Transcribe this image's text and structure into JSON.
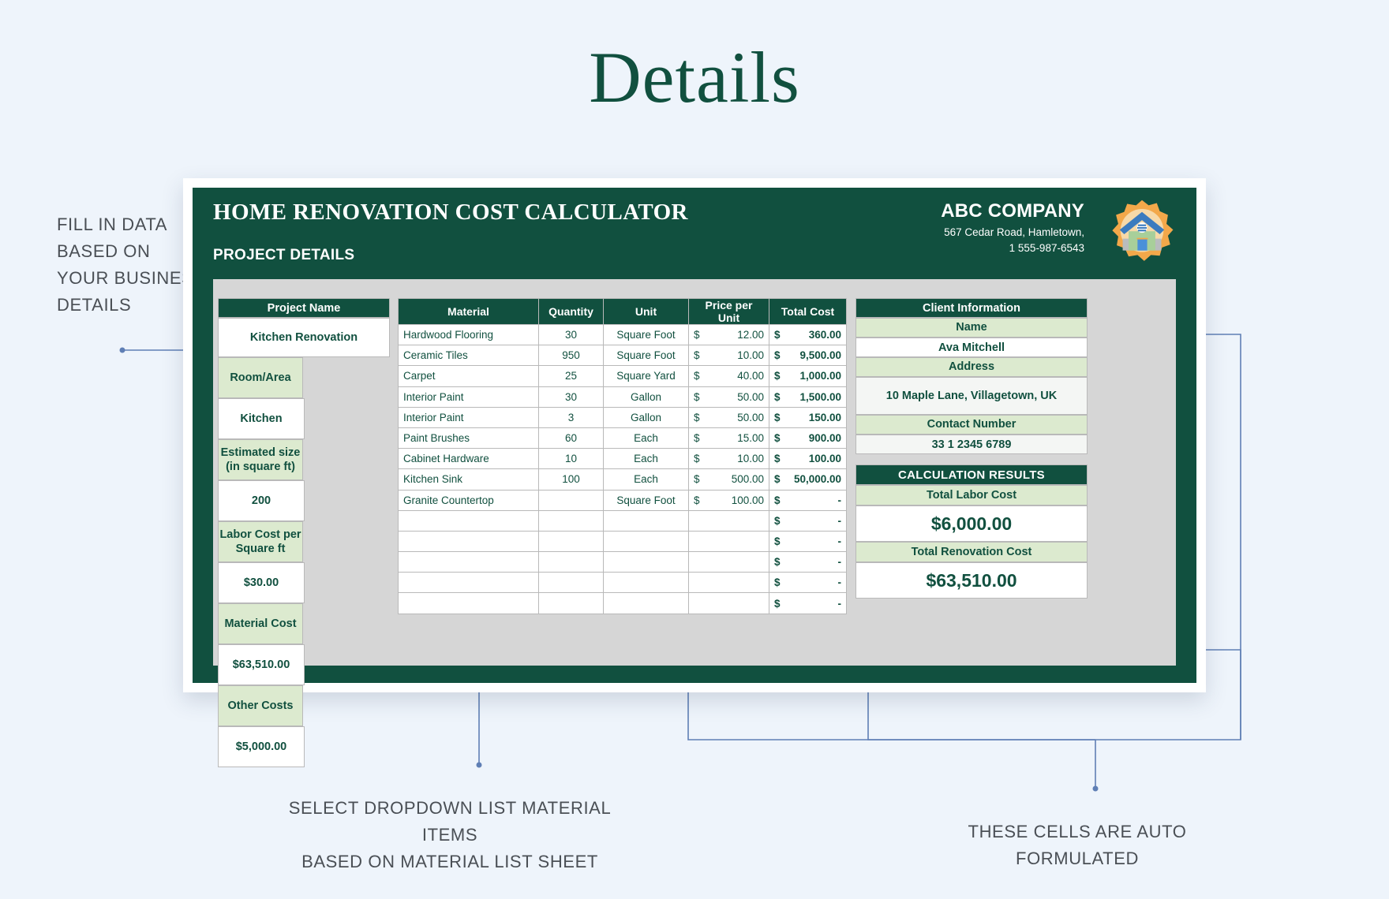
{
  "heading": "Details",
  "sheet": {
    "title": "HOME RENOVATION COST CALCULATOR",
    "subtitle": "PROJECT DETAILS",
    "company": {
      "name": "ABC COMPANY",
      "address": "567 Cedar Road, Hamletown,",
      "phone": "1 555-987-6543"
    },
    "logo_icon": "house-in-gear-icon"
  },
  "project_details": {
    "name_header": "Project Name",
    "name_value": "Kitchen Renovation",
    "rows": [
      {
        "label": "Room/Area",
        "value": "Kitchen"
      },
      {
        "label": "Estimated size (in square ft)",
        "label_line1": "Estimated size",
        "label_line2": "(in square ft)",
        "value": "200"
      },
      {
        "label": "Labor Cost per Square ft",
        "label_line1": "Labor Cost per",
        "label_line2": "Square ft",
        "value": "$30.00"
      },
      {
        "label": "Material Cost",
        "value": "$63,510.00"
      },
      {
        "label": "Other Costs",
        "value": "$5,000.00"
      }
    ]
  },
  "material_table": {
    "columns": [
      "Material",
      "Quantity",
      "Unit",
      "Price per Unit",
      "Total Cost"
    ],
    "currency_symbol": "$",
    "empty_total": "-",
    "rows": [
      {
        "material": "Hardwood Flooring",
        "quantity": "30",
        "unit": "Square Foot",
        "price": "12.00",
        "total": "360.00"
      },
      {
        "material": "Ceramic Tiles",
        "quantity": "950",
        "unit": "Square Foot",
        "price": "10.00",
        "total": "9,500.00"
      },
      {
        "material": "Carpet",
        "quantity": "25",
        "unit": "Square Yard",
        "price": "40.00",
        "total": "1,000.00"
      },
      {
        "material": "Interior Paint",
        "quantity": "30",
        "unit": "Gallon",
        "price": "50.00",
        "total": "1,500.00"
      },
      {
        "material": "Interior Paint",
        "quantity": "3",
        "unit": "Gallon",
        "price": "50.00",
        "total": "150.00"
      },
      {
        "material": "Paint Brushes",
        "quantity": "60",
        "unit": "Each",
        "price": "15.00",
        "total": "900.00"
      },
      {
        "material": "Cabinet Hardware",
        "quantity": "10",
        "unit": "Each",
        "price": "10.00",
        "total": "100.00"
      },
      {
        "material": "Kitchen Sink",
        "quantity": "100",
        "unit": "Each",
        "price": "500.00",
        "total": "50,000.00"
      },
      {
        "material": "Granite Countertop",
        "quantity": "",
        "unit": "Square Foot",
        "price": "100.00",
        "total": "-"
      },
      {
        "material": "",
        "quantity": "",
        "unit": "",
        "price": "",
        "total": "-"
      },
      {
        "material": "",
        "quantity": "",
        "unit": "",
        "price": "",
        "total": "-"
      },
      {
        "material": "",
        "quantity": "",
        "unit": "",
        "price": "",
        "total": "-"
      },
      {
        "material": "",
        "quantity": "",
        "unit": "",
        "price": "",
        "total": "-"
      },
      {
        "material": "",
        "quantity": "",
        "unit": "",
        "price": "",
        "total": "-"
      }
    ]
  },
  "client_info": {
    "header": "Client Information",
    "name_label": "Name",
    "name_value": "Ava Mitchell",
    "address_label": "Address",
    "address_value": "10 Maple Lane, Villagetown, UK",
    "contact_label": "Contact Number",
    "contact_value": "33 1 2345 6789"
  },
  "calculation_results": {
    "header": "CALCULATION RESULTS",
    "labor_label": "Total Labor Cost",
    "labor_value": "$6,000.00",
    "total_label": "Total Renovation Cost",
    "total_value": "$63,510.00"
  },
  "annotations": {
    "left": "FILL IN DATA BASED ON YOUR BUSINESS DETAILS",
    "middle_line1": "SELECT DROPDOWN LIST MATERIAL ITEMS",
    "middle_line2": "BASED ON MATERIAL LIST SHEET",
    "right": "THESE CELLS ARE AUTO FORMULATED"
  },
  "colors": {
    "dark_green": "#11503f",
    "light_green": "#dceacf",
    "page_bg": "#eef4fb",
    "work_gray": "#d6d6d6",
    "leader_blue": "#5f7fb5",
    "logo_orange": "#f3a84a"
  }
}
